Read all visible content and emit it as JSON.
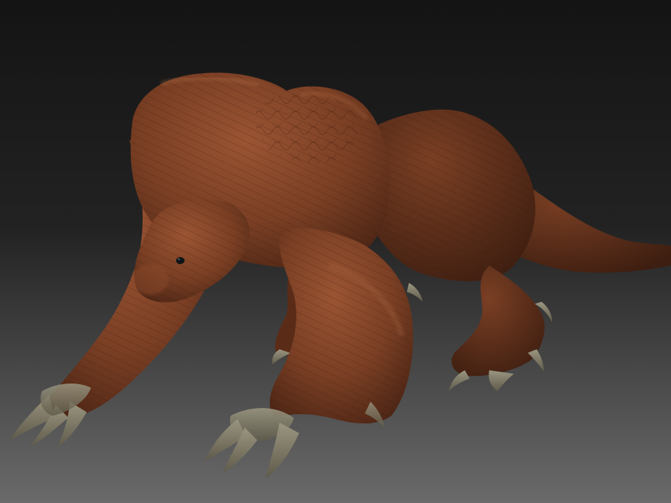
{
  "scene": {
    "subject": "creature-sculpt",
    "colors": {
      "background_top": "#141414",
      "background_bottom": "#6a6a6a",
      "skin_light": "#9a5433",
      "skin_mid": "#7a3f24",
      "skin_dark": "#4a2414",
      "claw_light": "#9a9680",
      "claw_dark": "#5f5a4a",
      "eye": "#0d1418"
    }
  }
}
